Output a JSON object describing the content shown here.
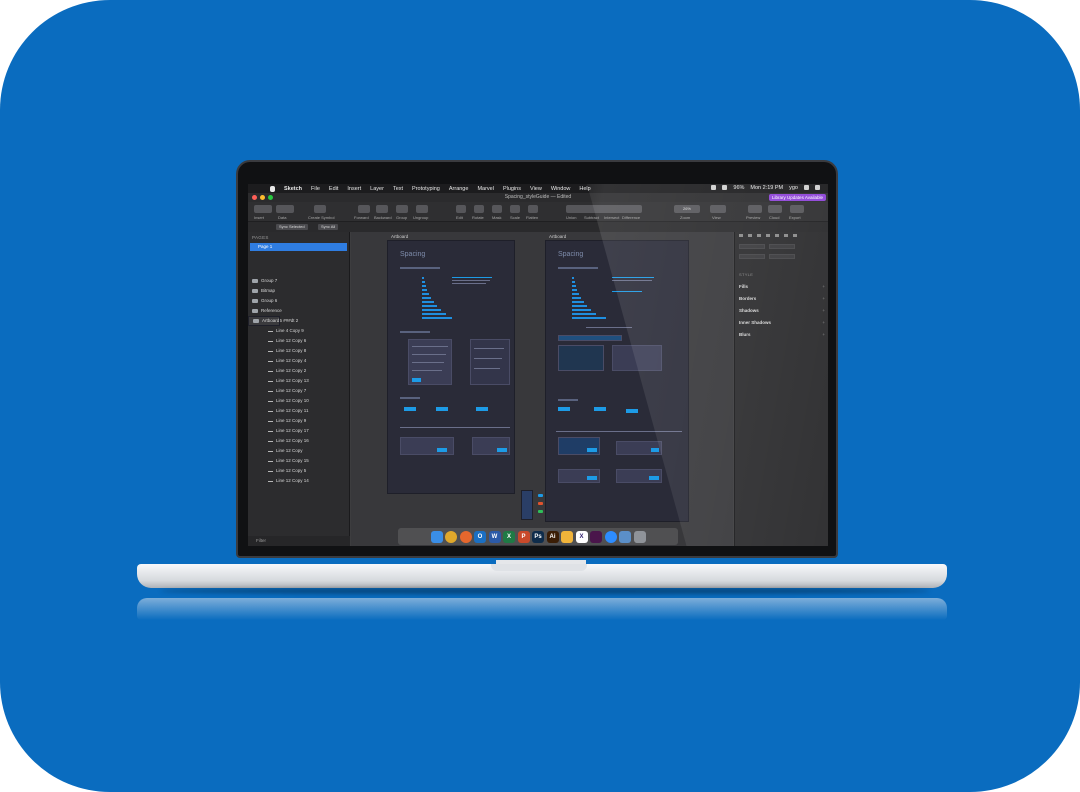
{
  "menubar": {
    "app_name": "Sketch",
    "menus": [
      "File",
      "Edit",
      "Insert",
      "Layer",
      "Text",
      "Prototyping",
      "Arrange",
      "Marvel",
      "Plugins",
      "View",
      "Window",
      "Help"
    ],
    "battery": "96%",
    "clock": "Mon 2:19 PM",
    "user": "ygo"
  },
  "window": {
    "title": "Spacing_styleGuide",
    "subtitle": "— Edited",
    "badge": "Library Updates Available"
  },
  "toolbar": {
    "labels": [
      "Insert",
      "Data",
      "Create Symbol",
      "Forward",
      "Backward",
      "Group",
      "Ungroup",
      "Edit",
      "Rotate",
      "Mask",
      "Scale",
      "Flatten",
      "Union",
      "Subtract",
      "Intersect",
      "Difference",
      "Zoom",
      "View",
      "Preview",
      "Cloud",
      "Export"
    ],
    "zoom": "26%"
  },
  "subbar": {
    "sync_selected": "Sync Selected",
    "sync_all": "Sync All"
  },
  "left_panel": {
    "pages_header": "PAGES",
    "page": "Page 1",
    "groups": [
      "Group 7",
      "Bitmap",
      "Group 6",
      "Reference"
    ],
    "artboard": "Artboard",
    "layers": [
      "25 ###dt 2",
      "Line 4 Copy 9",
      "Line 12 Copy 6",
      "Line 12 Copy 8",
      "Line 12 Copy 4",
      "Line 12 Copy 2",
      "Line 12 Copy 13",
      "Line 12 Copy 7",
      "Line 12 Copy 10",
      "Line 12 Copy 11",
      "Line 12 Copy 9",
      "Line 12 Copy 17",
      "Line 12 Copy 16",
      "Line 12 Copy",
      "Line 12 Copy 15",
      "Line 12 Copy 5",
      "Line 12 Copy 14"
    ],
    "filter": "Filter"
  },
  "canvas": {
    "artboard_label_1": "Artboard",
    "artboard_label_2": "Artboard",
    "heading_1": "Spacing",
    "heading_2": "Spacing"
  },
  "right_panel": {
    "style_header": "STYLE",
    "sections": [
      "Fills",
      "Borders",
      "Shadows",
      "Inner Shadows",
      "Blurs"
    ],
    "plus": "+"
  },
  "dock": {
    "apps": [
      {
        "name": "finder-icon",
        "color": "#3a8ee6",
        "glyph": ""
      },
      {
        "name": "chrome-icon",
        "color": "#e0a82b",
        "glyph": ""
      },
      {
        "name": "firefox-icon",
        "color": "#e5672d",
        "glyph": ""
      },
      {
        "name": "outlook-icon",
        "color": "#1b6fc2",
        "glyph": "O"
      },
      {
        "name": "word-icon",
        "color": "#2b5aa8",
        "glyph": "W"
      },
      {
        "name": "excel-icon",
        "color": "#1f7a45",
        "glyph": "X"
      },
      {
        "name": "powerpoint-icon",
        "color": "#c9492a",
        "glyph": "P"
      },
      {
        "name": "photoshop-icon",
        "color": "#0e2c4b",
        "glyph": "Ps"
      },
      {
        "name": "illustrator-icon",
        "color": "#3a1d05",
        "glyph": "Ai"
      },
      {
        "name": "sketch-icon",
        "color": "#f1b43a",
        "glyph": ""
      },
      {
        "name": "xd-icon",
        "color": "#ffffff",
        "glyph": "X"
      },
      {
        "name": "slack-icon",
        "color": "#4a154b",
        "glyph": ""
      },
      {
        "name": "zoom-icon",
        "color": "#2d8cff",
        "glyph": ""
      },
      {
        "name": "preview-icon",
        "color": "#5b8fc9",
        "glyph": ""
      },
      {
        "name": "trash-icon",
        "color": "#8f9399",
        "glyph": ""
      }
    ]
  },
  "colors": {
    "background": "#0a6cbf",
    "accent": "#2f7de1",
    "artboard": "#2a2b38",
    "highlight": "#1d9be6"
  }
}
